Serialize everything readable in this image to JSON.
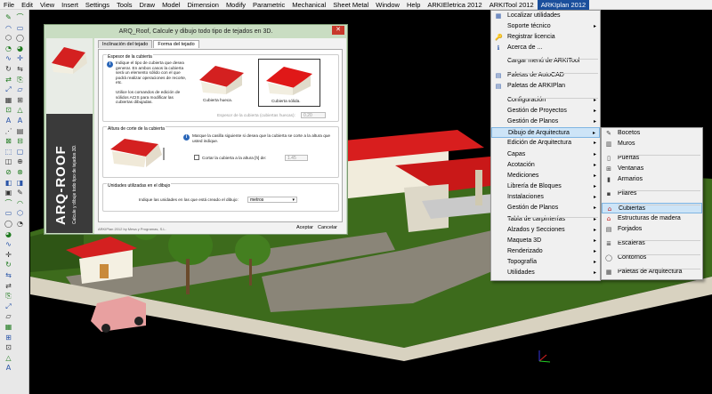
{
  "menubar": [
    "File",
    "Edit",
    "View",
    "Insert",
    "Settings",
    "Tools",
    "Draw",
    "Model",
    "Dimension",
    "Modify",
    "Parametric",
    "Mechanical",
    "Sheet Metal",
    "Window",
    "Help",
    "ARKIEletrica 2012",
    "ARKITool 2012",
    "ARKIplan 2012"
  ],
  "dialog": {
    "title": "ARQ_Roof, Calcule y dibujo todo tipo de tejados en 3D.",
    "close": "✕",
    "side_title": "ARQ-ROOF",
    "side_subtitle": "Calcule y dibuje todo tipo de tejados 3D.",
    "tabs": [
      "Inclinación del tejado",
      "Forma del tejado"
    ],
    "group1": {
      "title": "Espesor de la cubierta",
      "text1": "Indique el tipo de cubierta que desea generar. En ambos casos la cubierta será un elemento sólido con el que podrá realizar operaciones de recorte, etc.",
      "text2": "Utilice los comandos de edición de sólidos ACIS para modificar las cubiertas dibujadas.",
      "opt1": "Cubierta hueca.",
      "opt2": "Cubierta sólida.",
      "thickness_label": "Espesor de la cubierta (cubiertas huecas):",
      "thickness_value": "0.20"
    },
    "group2": {
      "title": "Altura de corte de la cubierta",
      "info": "Marque la casilla siguiente si desea que la cubierta se corte a la altura que usted indique.",
      "check_label": "Cortar la cubierta a la altura [h] de:",
      "height_value": "1.45"
    },
    "group3": {
      "title": "Unidades utilizadas en el dibujo",
      "label": "Indique las unidades en las que está creado el dibujo:",
      "value": "metros"
    },
    "footer": "ARKIPlan 2012 by Mesa y Programas, S.L.",
    "accept": "Aceptar",
    "cancel": "Cancelar"
  },
  "menu1": [
    {
      "label": "Localizar utilidades",
      "icon": "▦"
    },
    {
      "label": "Soporte técnico",
      "icon": "",
      "arrow": "▸"
    },
    {
      "label": "Registrar licencia",
      "icon": "🔑"
    },
    {
      "label": "Acerca de ...",
      "icon": "ℹ"
    },
    {
      "label": "Cargar menú de ARKITool",
      "icon": ""
    },
    {
      "label": "Paletas de AutoCAD",
      "icon": "▤"
    },
    {
      "label": "Paletas de ARKIPlan",
      "icon": "▤"
    },
    {
      "label": "Configuración",
      "icon": "",
      "arrow": "▸"
    },
    {
      "label": "Gestión de Proyectos",
      "icon": "",
      "arrow": "▸"
    },
    {
      "label": "Gestión de Planos",
      "icon": "",
      "arrow": "▸"
    },
    {
      "label": "Dibujo de Arquitectura",
      "icon": "",
      "arrow": "▸"
    },
    {
      "label": "Edición de Arquitectura",
      "icon": "",
      "arrow": "▸"
    },
    {
      "label": "Capas",
      "icon": "",
      "arrow": "▸"
    },
    {
      "label": "Acotación",
      "icon": "",
      "arrow": "▸"
    },
    {
      "label": "Mediciones",
      "icon": "",
      "arrow": "▸"
    },
    {
      "label": "Librería de Bloques",
      "icon": "",
      "arrow": "▸"
    },
    {
      "label": "Instalaciones",
      "icon": "",
      "arrow": "▸"
    },
    {
      "label": "Gestión de Planos",
      "icon": "",
      "arrow": "▸"
    },
    {
      "label": "Tabla de carpinterías",
      "icon": "",
      "arrow": "▸"
    },
    {
      "label": "Alzados y Secciones",
      "icon": "",
      "arrow": "▸"
    },
    {
      "label": "Maqueta 3D",
      "icon": "",
      "arrow": "▸"
    },
    {
      "label": "Renderizado",
      "icon": "",
      "arrow": "▸"
    },
    {
      "label": "Topografía",
      "icon": "",
      "arrow": "▸"
    },
    {
      "label": "Utilidades",
      "icon": "",
      "arrow": "▸"
    }
  ],
  "menu2": [
    {
      "label": "Bocetos",
      "icon": "✎"
    },
    {
      "label": "Muros",
      "icon": "▥"
    },
    {
      "label": "Puertas",
      "icon": "▯"
    },
    {
      "label": "Ventanas",
      "icon": "⊞"
    },
    {
      "label": "Armarios",
      "icon": "▮"
    },
    {
      "label": "Pilares",
      "icon": "▪"
    },
    {
      "label": "Cubiertas",
      "icon": "⌂"
    },
    {
      "label": "Estructuras de madera",
      "icon": "⌂"
    },
    {
      "label": "Forjados",
      "icon": "▤"
    },
    {
      "label": "Escaleras",
      "icon": "≣"
    },
    {
      "label": "Contornos",
      "icon": "◯"
    },
    {
      "label": "Paletas de Arquitectura",
      "icon": "▦"
    }
  ]
}
